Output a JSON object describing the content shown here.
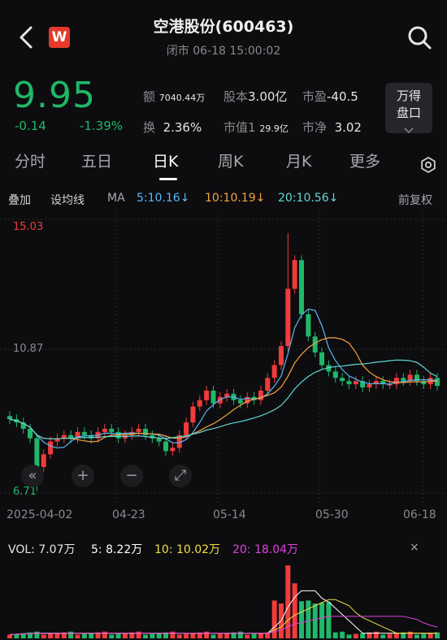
{
  "header": {
    "title": "空港股份(600463)",
    "subtitle": "闭市 06-18 15:00:02",
    "logo_text": "W"
  },
  "quote": {
    "price": "9.95",
    "change": "-0.14",
    "change_pct": "-1.39%",
    "amount_label": "额",
    "amount_value": "7040.44万",
    "capital_label": "股本",
    "capital_value": "3.00亿",
    "pe_label": "市盈",
    "pe_value": "-40.5",
    "turnover_label": "换",
    "turnover_value": "2.36%",
    "mktcap_label": "市值1",
    "mktcap_value": "29.9亿",
    "pb_label": "市净",
    "pb_value": "3.02",
    "pankou_line1": "万得",
    "pankou_line2": "盘口",
    "colors": {
      "up": "#f03c3c",
      "down": "#1fb86a"
    }
  },
  "tabs": [
    "分时",
    "五日",
    "日K",
    "周K",
    "月K",
    "更多"
  ],
  "active_tab": "日K",
  "indicators": {
    "overlay": "叠加",
    "set_ma": "设均线",
    "ma_label": "MA",
    "ma5": "5:10.16↓",
    "ma10": "10:10.19↓",
    "ma20": "20:10.56↓",
    "adjust": "前复权",
    "colors": {
      "ma5": "#5bb8f5",
      "ma10": "#f5a442",
      "ma20": "#62d6d6"
    }
  },
  "chart": {
    "high_label": "15.03",
    "mid_label": "10.87",
    "low_label": "6.71",
    "dates": [
      "2025-04-02",
      "04-23",
      "05-14",
      "05-30",
      "06-18"
    ],
    "controls": [
      "«",
      "+",
      "−",
      "⤢"
    ]
  },
  "volume": {
    "vol": "VOL: 7.07万",
    "ma5": "5: 8.22万",
    "ma10": "10: 10.02万",
    "ma20": "20: 18.04万",
    "close": "×",
    "colors": {
      "ma5": "#ffffff",
      "ma10": "#f0e040",
      "ma20": "#e040e0"
    }
  }
}
